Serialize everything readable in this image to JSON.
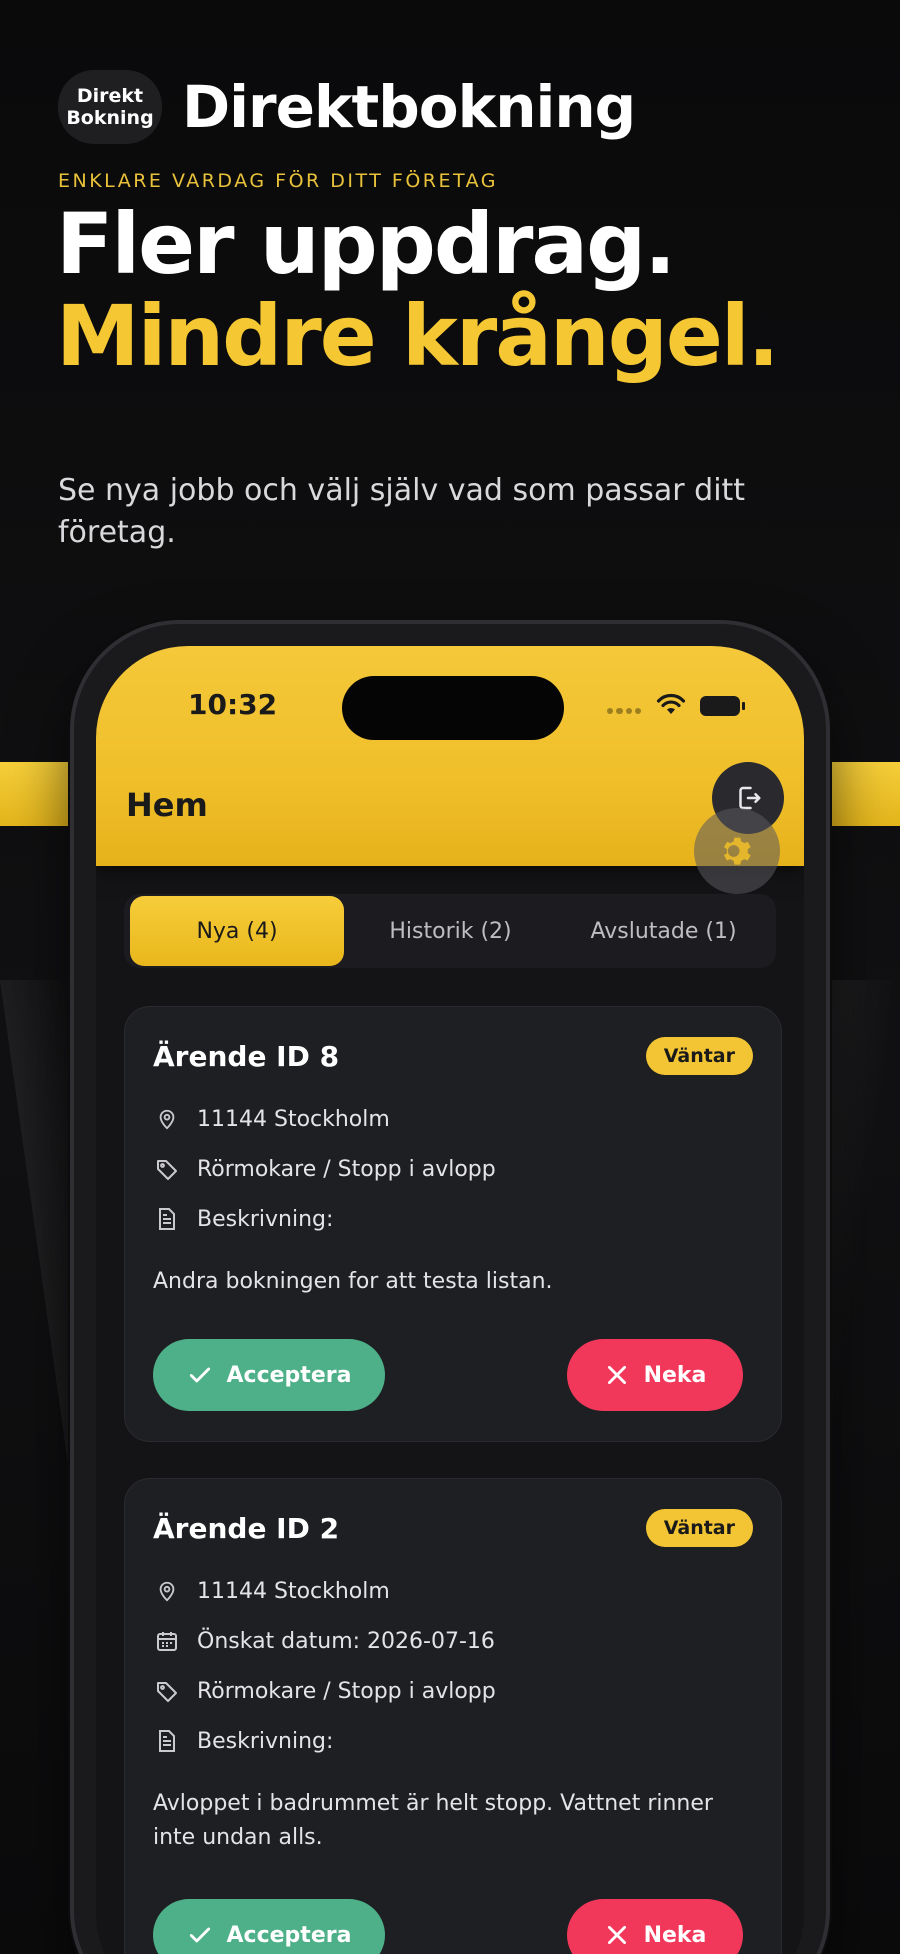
{
  "brand": {
    "logo_line1": "Direkt",
    "logo_line2": "Bokning",
    "name": "Direktbokning"
  },
  "hero": {
    "tagline": "ENKLARE VARDAG FÖR DITT FÖRETAG",
    "headline_line1": "Fler uppdrag.",
    "headline_line2": "Mindre krångel.",
    "subtext": "Se nya jobb och välj själv vad som passar ditt företag."
  },
  "status_bar": {
    "time": "10:32"
  },
  "app": {
    "title": "Hem",
    "tabs": [
      {
        "label": "Nya (4)",
        "active": true
      },
      {
        "label": "Historik (2)",
        "active": false
      },
      {
        "label": "Avslutade (1)",
        "active": false
      }
    ]
  },
  "cards": [
    {
      "title": "Ärende ID 8",
      "status": "Väntar",
      "location": "11144 Stockholm",
      "category": "Rörmokare / Stopp i avlopp",
      "description_label": "Beskrivning:",
      "description": "Andra bokningen for att testa listan.",
      "accept_label": "Acceptera",
      "deny_label": "Neka"
    },
    {
      "title": "Ärende ID 2",
      "status": "Väntar",
      "location": "11144 Stockholm",
      "date": "Önskat datum: 2026-07-16",
      "category": "Rörmokare / Stopp i avlopp",
      "description_label": "Beskrivning:",
      "description": "Avloppet i badrummet är helt stopp. Vattnet rinner inte undan alls.",
      "accept_label": "Acceptera",
      "deny_label": "Neka"
    }
  ],
  "colors": {
    "accent_yellow": "#f3c534",
    "accept_green": "#4db089",
    "deny_red": "#f2385a"
  }
}
